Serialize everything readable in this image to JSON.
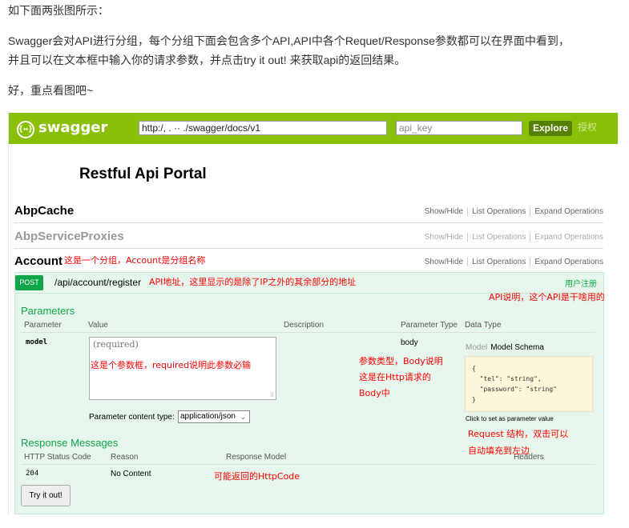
{
  "article": {
    "line1": "如下面两张图所示：",
    "line2": "Swagger会对API进行分组，每个分组下面会包含多个API,API中各个Requet/Response参数都可以在界面中看到，",
    "line3": "并且可以在文本框中输入你的请求参数，并点击try it out! 来获取api的返回结果。",
    "line4": "好，重点看图吧~"
  },
  "swagger": {
    "logo_symbol": "{↔}",
    "logo_text": "swagger",
    "url_value": "http:/,              .            ··    ./swagger/docs/v1",
    "api_key_placeholder": "api_key",
    "explore_label": "Explore",
    "auth_label": "授权",
    "portal_title": "Restful Api Portal",
    "groups": [
      {
        "name": "AbpCache",
        "show_hide": "Show/Hide",
        "list_ops": "List Operations",
        "expand_ops": "Expand Operations"
      },
      {
        "name": "AbpServiceProxies",
        "show_hide": "Show/Hide",
        "list_ops": "List Operations",
        "expand_ops": "Expand Operations"
      },
      {
        "name": "Account",
        "show_hide": "Show/Hide",
        "list_ops": "List Operations",
        "expand_ops": "Expand Operations"
      }
    ],
    "operation": {
      "method": "POST",
      "path": "/api/account/register",
      "summary": "用户注册",
      "parameters_title": "Parameters",
      "param_headers": {
        "parameter": "Parameter",
        "value": "Value",
        "description": "Description",
        "param_type": "Parameter Type",
        "data_type": "Data Type"
      },
      "param": {
        "name": "model",
        "placeholder": "(required)",
        "type": "body",
        "content_type_label": "Parameter content type:",
        "content_type_value": "application/json"
      },
      "schema": {
        "tab_model": "Model",
        "tab_schema": "Model Schema",
        "line1": "{",
        "line2": "  \"tel\": \"string\",",
        "line3": "  \"password\": \"string\"",
        "line4": "}",
        "hint": "Click to set as parameter value"
      },
      "response_title": "Response Messages",
      "response_headers": {
        "status": "HTTP Status Code",
        "reason": "Reason",
        "model": "Response Model",
        "headers": "Headers"
      },
      "response_row": {
        "status": "204",
        "reason": "No Content"
      },
      "try_label": "Try it out!"
    }
  },
  "annotations": {
    "group_note": "这是一个分组，Account是分组名称",
    "path_note": "API地址，这里显示的是除了IP之外的其余部分的地址",
    "summary_note": "API说明，这个API是干啥用的",
    "param_note": "这是个参数框，required说明此参数必输",
    "type_note_1": "参数类型，Body说明",
    "type_note_2": "这是在Http请求的",
    "type_note_3": "Body中",
    "schema_note_1": "Request 结构，双击可以",
    "schema_note_2": "自动填充到左边",
    "code_note": "可能返回的HttpCode"
  }
}
